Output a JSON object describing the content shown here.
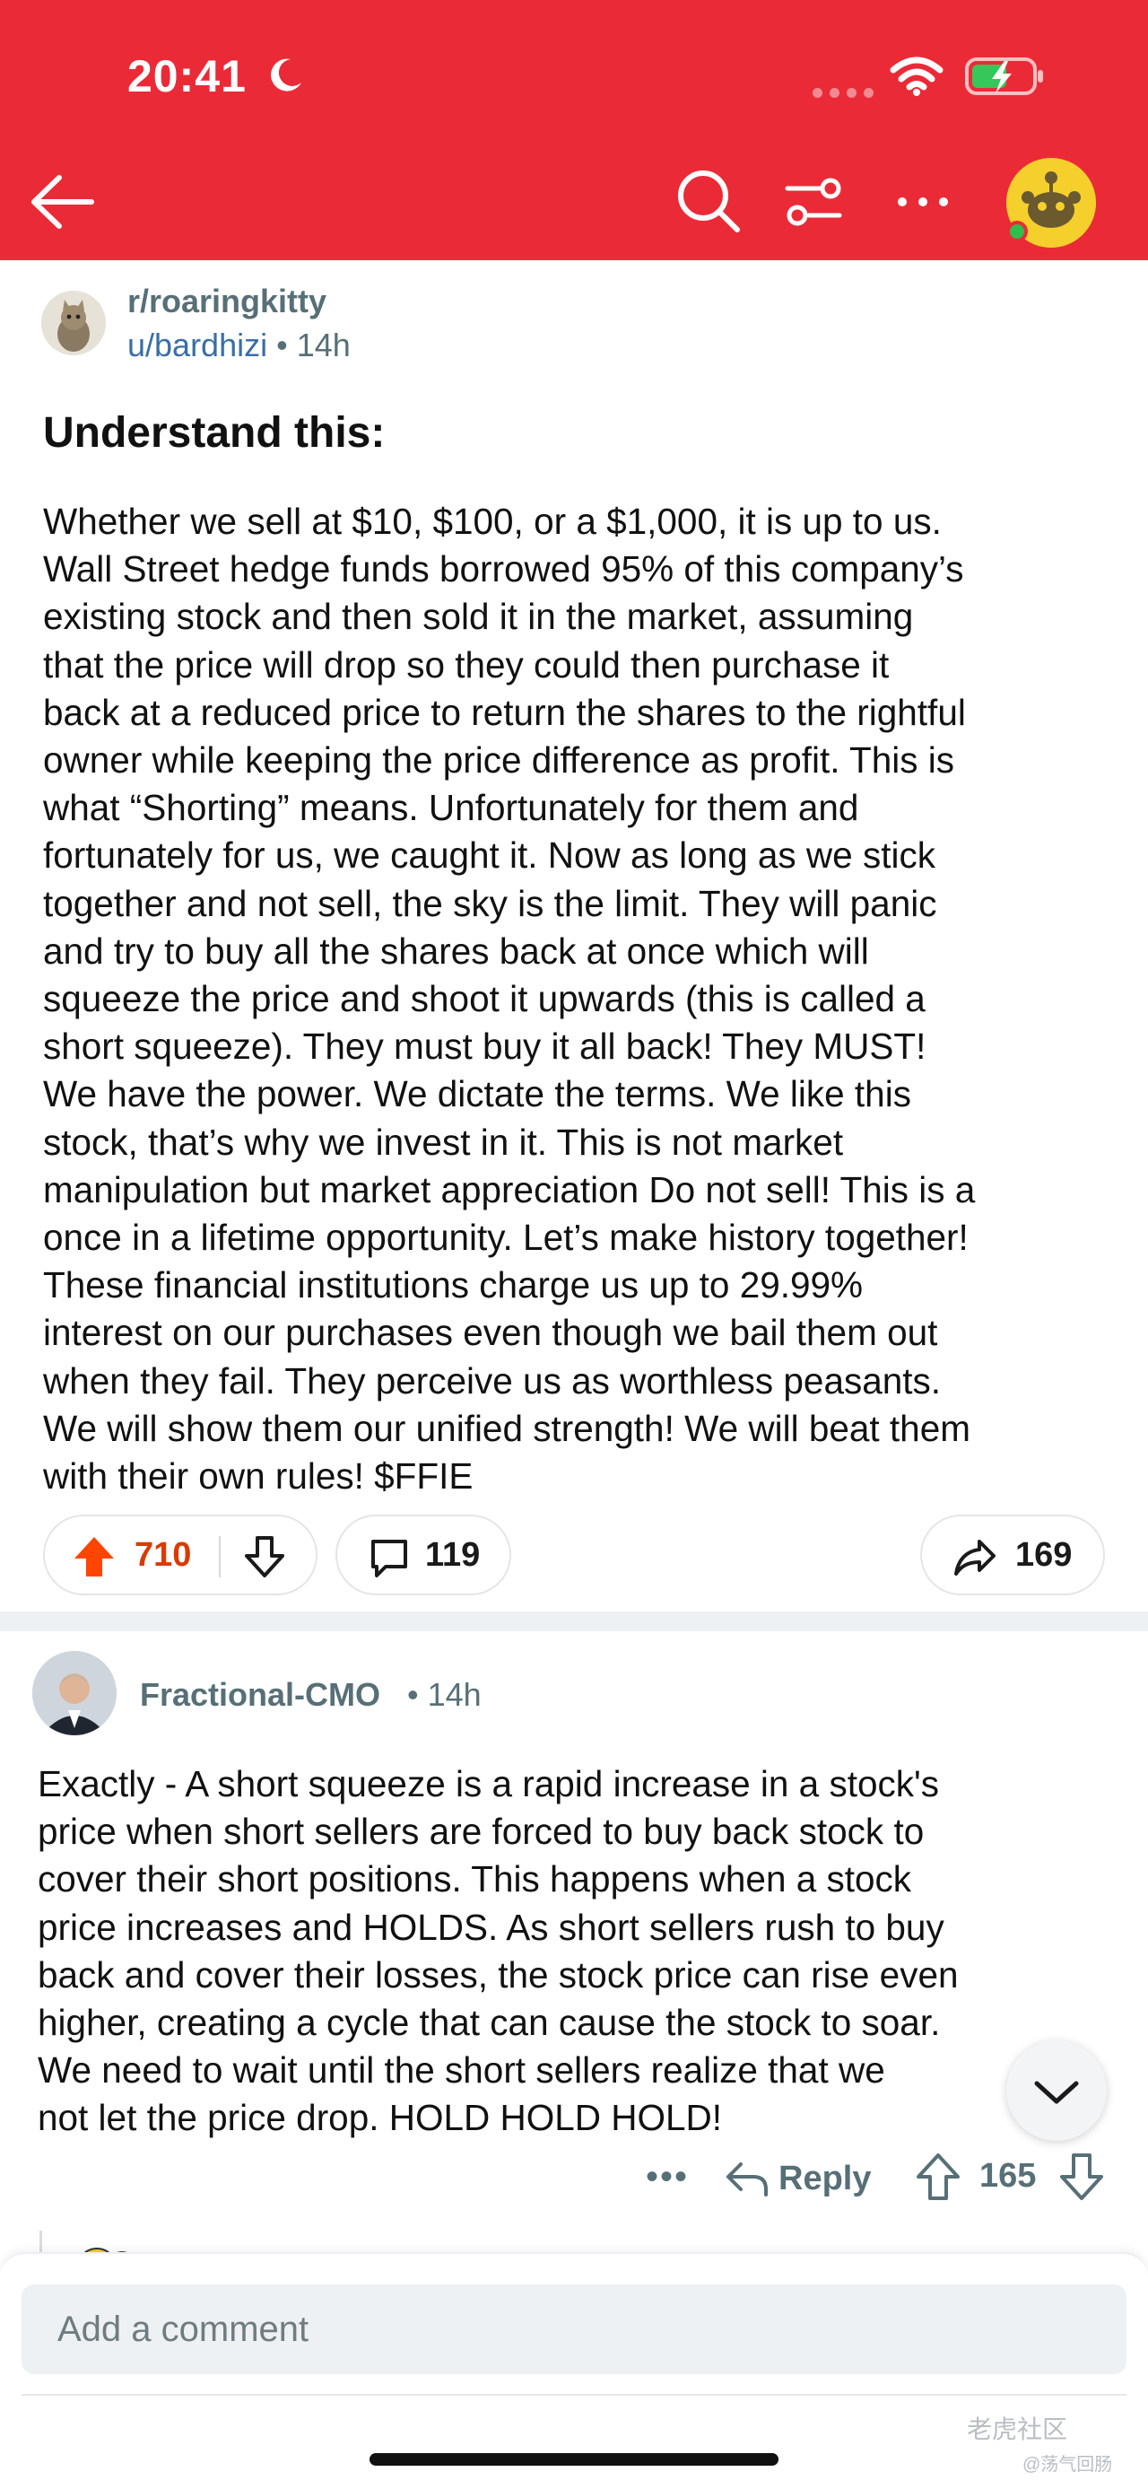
{
  "status_bar": {
    "time": "20:41"
  },
  "toolbar": {
    "back_icon": "arrow-left-icon",
    "search_icon": "search-icon",
    "filter_icon": "sliders-icon",
    "more_icon": "ellipsis-icon",
    "avatar_icon": "snoo-avatar-icon",
    "header_color": "#ea2b37"
  },
  "post": {
    "subreddit": "r/roaringkitty",
    "author": "u/bardhizi",
    "age": "14h",
    "title": "Understand this:",
    "body_lines": [
      "Whether we sell at $10, $100, or a $1,000, it is up to us.",
      "Wall Street hedge funds borrowed 95% of this company’s",
      "existing stock and then sold it in the market, assuming",
      "that the price will drop so they could then purchase it",
      "back at a reduced price to return the shares to the rightful",
      "owner while keeping the price difference as profit. This is",
      "what “Shorting” means. Unfortunately for them and",
      "fortunately for us, we caught it. Now as long as we stick",
      "together and not sell, the sky is the limit. They will panic",
      "and try to buy all the shares back at once which will",
      "squeeze the price and shoot it upwards (this is called a",
      "short squeeze). They must buy it all back! They MUST!",
      "We have the power. We dictate the terms. We like this",
      "stock, that’s why we invest in it. This is not market",
      "manipulation but market appreciation Do not sell! This is a",
      "once in a lifetime opportunity. Let’s make history together!",
      "These financial institutions charge us up to 29.99%",
      "interest on our purchases even though we bail them out",
      "when they fail. They perceive us as worthless peasants.",
      "We will show them our unified strength! We will beat them",
      "with their own rules! $FFIE"
    ],
    "upvotes": "710",
    "comments": "119",
    "shares": "169",
    "upvote_color": "#ff4500"
  },
  "comment": {
    "author": "Fractional-CMO",
    "age": "• 14h",
    "body_lines": [
      "Exactly - A short squeeze is a rapid increase in a stock's",
      "price when short sellers are forced to buy back stock to",
      "cover their short positions. This happens when a stock",
      "price increases and HOLDS. As short sellers rush to buy",
      "back and cover their losses, the stock price can rise even",
      "higher, creating a cycle that can cause the stock to soar.",
      "We need to wait until the short sellers realize that we",
      "not let the price drop. HOLD HOLD HOLD!"
    ],
    "more_label": "•••",
    "reply_label": "Reply",
    "score": "165"
  },
  "composer": {
    "placeholder": "Add a comment"
  },
  "watermark": {
    "brand": "老虎社区",
    "handle": "@荡气回肠"
  }
}
